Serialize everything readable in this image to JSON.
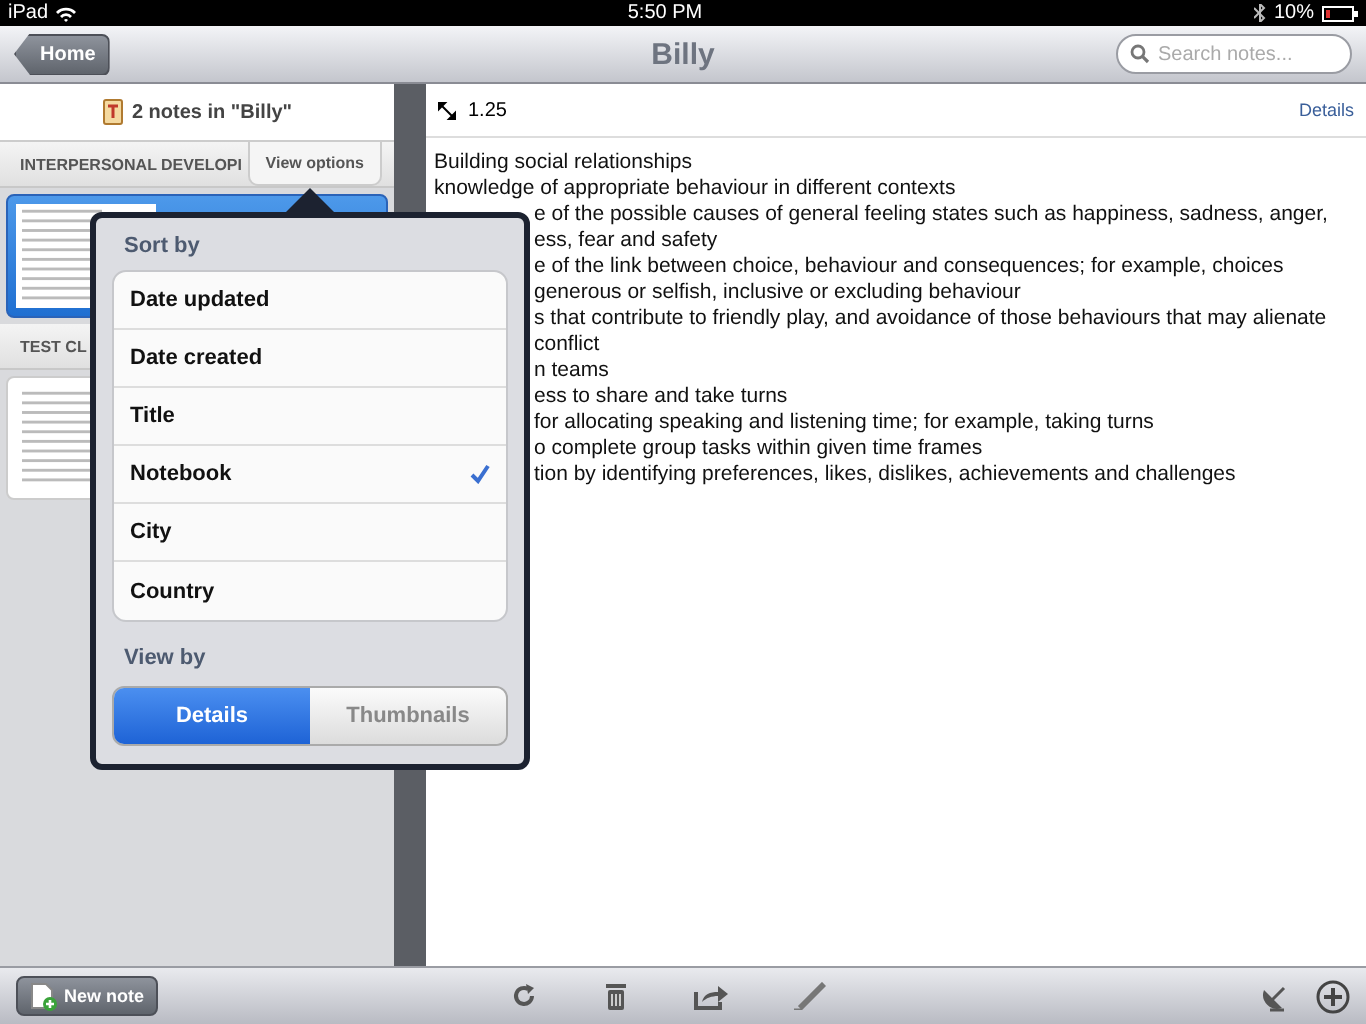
{
  "status_bar": {
    "device": "iPad",
    "time": "5:50 PM",
    "battery": "10%"
  },
  "nav": {
    "back_button": "Home",
    "title": "Billy",
    "search": {
      "placeholder": "Search notes..."
    }
  },
  "sidebar": {
    "header": "2 notes in \"Billy\"",
    "view_options": "View options",
    "sections": [
      {
        "title": "INTERPERSONAL DEVELOPI",
        "notes": [
          {
            "selected": true
          }
        ]
      },
      {
        "title": "TEST CL",
        "notes": [
          {
            "selected": false
          }
        ]
      }
    ]
  },
  "note": {
    "zoom": "1.25",
    "details_link": "Details",
    "lines": [
      "Building social relationships",
      "knowledge of appropriate behaviour in different contexts"
    ],
    "lines_beside_popover": [
      "e of the possible causes of general feeling states such as happiness, sadness, anger,",
      "ess, fear and safety",
      "e of the link between choice, behaviour and consequences; for example, choices",
      "generous or selfish, inclusive or excluding behaviour",
      "s that contribute to friendly play, and avoidance of those behaviours that may alienate",
      "conflict",
      "n teams",
      "ess to share and take turns",
      "for allocating speaking and listening time; for example, taking turns",
      "o complete group tasks within given time frames",
      "tion by identifying preferences, likes, dislikes, achievements and challenges"
    ]
  },
  "popover": {
    "sort_title": "Sort by",
    "sort_options": [
      {
        "label": "Date updated",
        "selected": false
      },
      {
        "label": "Date created",
        "selected": false
      },
      {
        "label": "Title",
        "selected": false
      },
      {
        "label": "Notebook",
        "selected": true
      },
      {
        "label": "City",
        "selected": false
      },
      {
        "label": "Country",
        "selected": false
      }
    ],
    "view_title": "View by",
    "view_segments": [
      {
        "label": "Details",
        "selected": true
      },
      {
        "label": "Thumbnails",
        "selected": false
      }
    ]
  },
  "toolbar": {
    "new_note": "New note"
  }
}
